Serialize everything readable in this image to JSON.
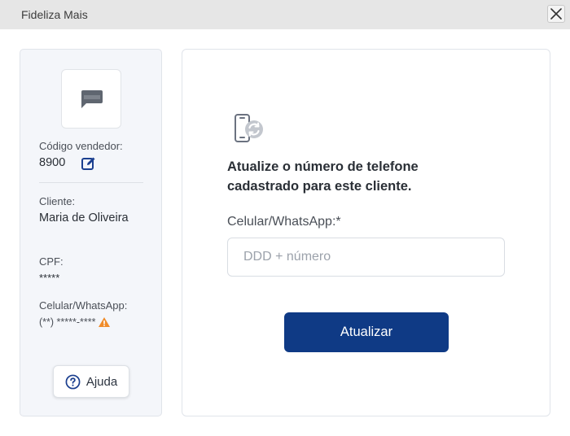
{
  "window": {
    "title": "Fideliza Mais"
  },
  "seller": {
    "code_label": "Código vendedor:",
    "code_value": "8900"
  },
  "customer": {
    "name_label": "Cliente:",
    "name_value": "Maria de Oliveira",
    "cpf_label": "CPF:",
    "cpf_value": "*****",
    "phone_label": "Celular/WhatsApp:",
    "phone_value": "(**) *****-****"
  },
  "help": {
    "label": "Ajuda"
  },
  "form": {
    "heading": "Atualize o número de telefone cadastrado para este cliente.",
    "field_label": "Celular/WhatsApp:*",
    "field_value": "",
    "field_placeholder": "DDD + número",
    "submit_label": "Atualizar"
  },
  "colors": {
    "primary": "#0f3a85",
    "warning": "#f08c2b",
    "panel_bg": "#f4f6fa",
    "titlebar_bg": "#e6e6e6"
  },
  "icons": [
    "close-icon",
    "chat-bubble-icon",
    "edit-icon",
    "warning-icon",
    "help-circle-icon",
    "phone-refresh-icon"
  ]
}
